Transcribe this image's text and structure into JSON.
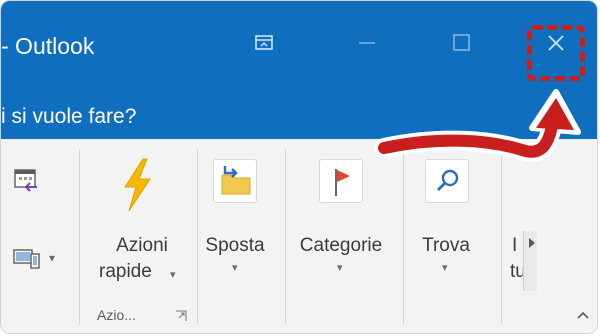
{
  "window": {
    "title": "- Outlook",
    "buttons": {
      "restore": "ribbon-display-options-icon",
      "minimize": "minimize-icon",
      "maximize": "maximize-icon",
      "close": "close-icon"
    }
  },
  "tell_me": {
    "text": "i si vuole fare?"
  },
  "ribbon": {
    "groups": [
      {
        "name": "azioni-rapide-group",
        "label": "Azio...",
        "buttons": [
          {
            "id": "quick-steps",
            "line1": "Azioni",
            "line2": "rapide",
            "icon": "lightning-icon"
          }
        ]
      },
      {
        "name": "sposta-group",
        "buttons": [
          {
            "id": "move",
            "label": "Sposta",
            "icon": "move-folder-icon"
          }
        ]
      },
      {
        "name": "categorie-group",
        "buttons": [
          {
            "id": "tags",
            "label": "Categorie",
            "icon": "flag-icon"
          }
        ]
      },
      {
        "name": "trova-group",
        "buttons": [
          {
            "id": "find",
            "label": "Trova",
            "icon": "search-icon"
          }
        ]
      },
      {
        "name": "truncated-group",
        "buttons": [
          {
            "id": "truncated",
            "line1": "I",
            "line2": "tu",
            "icon": "scroll-right-icon"
          }
        ]
      }
    ],
    "left_small_icons": [
      "calendar-reply-icon",
      "devices-icon"
    ],
    "collapse_icon": "chevron-up-icon"
  },
  "colors": {
    "title_bar": "#106ebe",
    "ribbon_bg": "#f3f3f3",
    "annotation_red": "#c81e1e",
    "lightning": "#f5b800",
    "flag": "#e0442a",
    "folder": "#f2c94c"
  }
}
